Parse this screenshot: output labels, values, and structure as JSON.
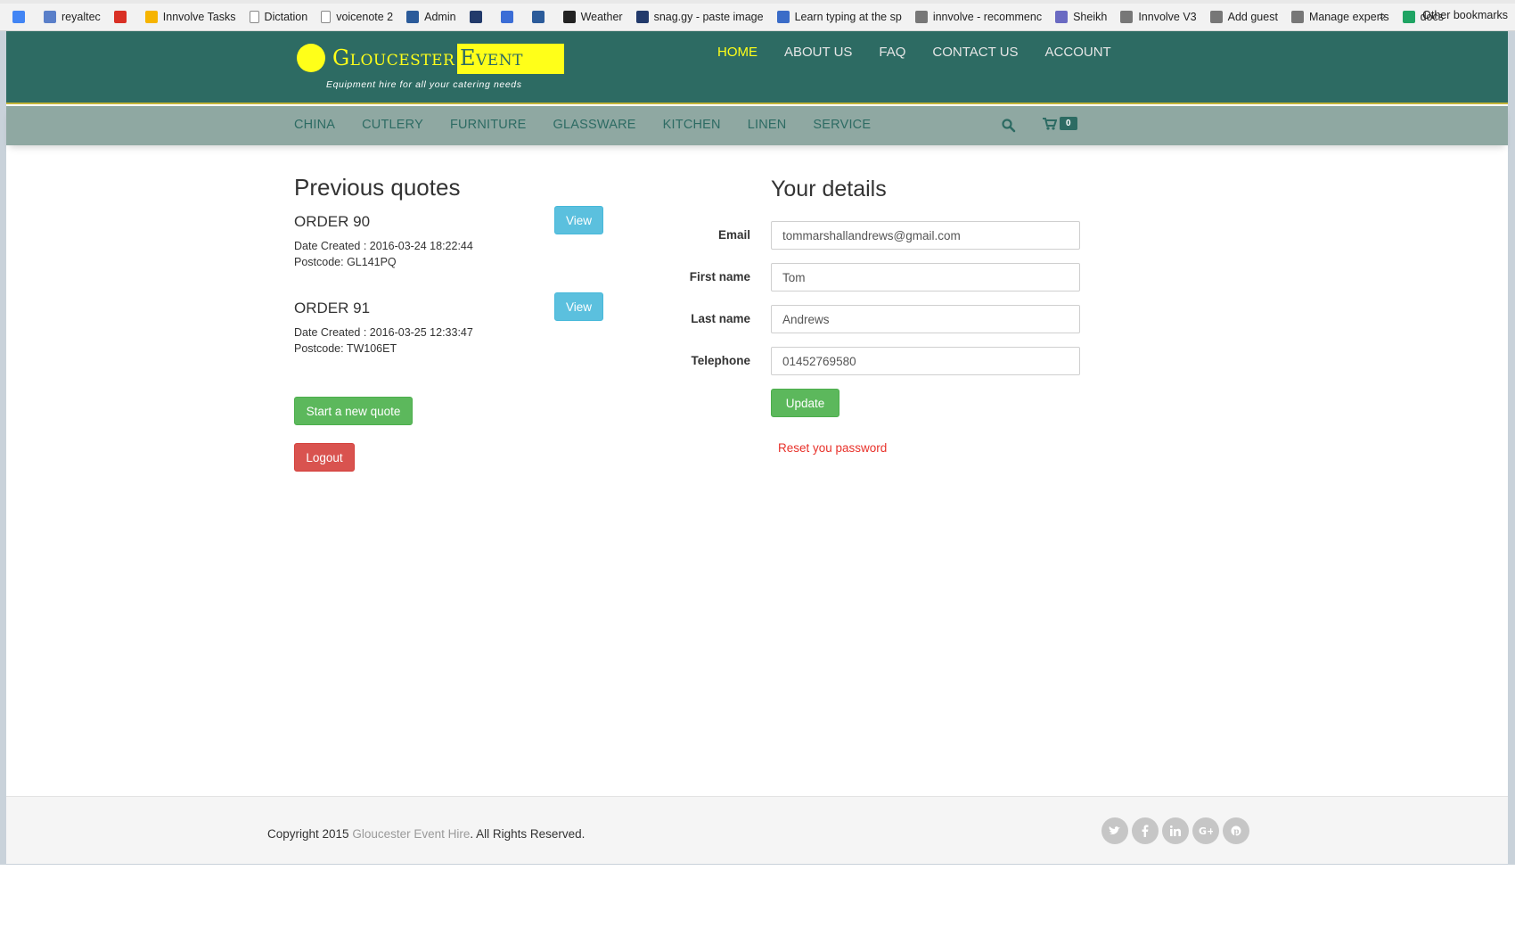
{
  "bookmarks": [
    {
      "label": "",
      "icon": "google-icon",
      "color": "#4285f4"
    },
    {
      "label": "reyaltec",
      "icon": "translate-icon",
      "color": "#5a7fc9"
    },
    {
      "label": "",
      "icon": "red-bars-icon",
      "color": "#d93025"
    },
    {
      "label": "Innvolve Tasks",
      "icon": "keep-icon",
      "color": "#f6b400"
    },
    {
      "label": "Dictation",
      "icon": "page-icon",
      "color": "#ffffff"
    },
    {
      "label": "voicenote 2",
      "icon": "page-icon",
      "color": "#ffffff"
    },
    {
      "label": "Admin",
      "icon": "link-icon",
      "color": "#2b5b9a"
    },
    {
      "label": "",
      "icon": "sg-icon",
      "color": "#223a6b"
    },
    {
      "label": "",
      "icon": "calendar-icon",
      "color": "#3b6dd6"
    },
    {
      "label": "",
      "icon": "link-icon",
      "color": "#2b5b9a"
    },
    {
      "label": "Weather",
      "icon": "bbc-icon",
      "color": "#222222"
    },
    {
      "label": "snag.gy - paste image",
      "icon": "sg-icon",
      "color": "#223a6b"
    },
    {
      "label": "Learn typing at the sp",
      "icon": "keyboard-icon",
      "color": "#3a6cc8"
    },
    {
      "label": "innvolve - recommenc",
      "icon": "person-icon",
      "color": "#777777"
    },
    {
      "label": "Sheikh",
      "icon": "check-circle-icon",
      "color": "#6a6ac2"
    },
    {
      "label": "Innvolve V3",
      "icon": "person-icon",
      "color": "#777777"
    },
    {
      "label": "Add guest",
      "icon": "person-icon",
      "color": "#777777"
    },
    {
      "label": "Manage experts",
      "icon": "person-icon",
      "color": "#777777"
    },
    {
      "label": "docs",
      "icon": "drive-icon",
      "color": "#1fa463"
    }
  ],
  "bookmarks_more": "»",
  "bookmarks_other": "Other bookmarks",
  "logo": {
    "name_a": "Gloucester",
    "name_b": "Event Hire",
    "tagline": "Equipment hire for all your catering needs"
  },
  "topnav": [
    "HOME",
    "ABOUT US",
    "FAQ",
    "CONTACT US",
    "ACCOUNT"
  ],
  "categories": [
    "CHINA",
    "CUTLERY",
    "FURNITURE",
    "GLASSWARE",
    "KITCHEN",
    "LINEN",
    "SERVICE"
  ],
  "cart_count": "0",
  "previous_quotes": {
    "title": "Previous quotes",
    "orders": [
      {
        "title": "ORDER 90",
        "date": "Date Created : 2016-03-24 18:22:44",
        "postcode": "Postcode: GL141PQ",
        "view_label": "View"
      },
      {
        "title": "ORDER 91",
        "date": "Date Created : 2016-03-25 12:33:47",
        "postcode": "Postcode: TW106ET",
        "view_label": "View"
      }
    ],
    "new_quote_label": "Start a new quote",
    "logout_label": "Logout"
  },
  "details": {
    "title": "Your details",
    "email_label": "Email",
    "email_value": "tommarshallandrews@gmail.com",
    "first_name_label": "First name",
    "first_name_value": "Tom",
    "last_name_label": "Last name",
    "last_name_value": "Andrews",
    "telephone_label": "Telephone",
    "telephone_value": "01452769580",
    "update_label": "Update",
    "reset_label": "Reset you password"
  },
  "footer": {
    "copy_prefix": "Copyright 2015 ",
    "brand": "Gloucester Event Hire",
    "copy_suffix": ". All Rights Reserved.",
    "social": [
      "twitter-icon",
      "facebook-icon",
      "linkedin-icon",
      "google-plus-icon",
      "pinterest-icon"
    ]
  },
  "colors": {
    "header": "#2d6b63",
    "catbar": "#8fa8a2",
    "logo_yellow": "#ffff19",
    "view_button": "#5bc0de",
    "green_button": "#5cb85c",
    "red_button": "#d9534f",
    "reset_link": "#e8312a"
  }
}
